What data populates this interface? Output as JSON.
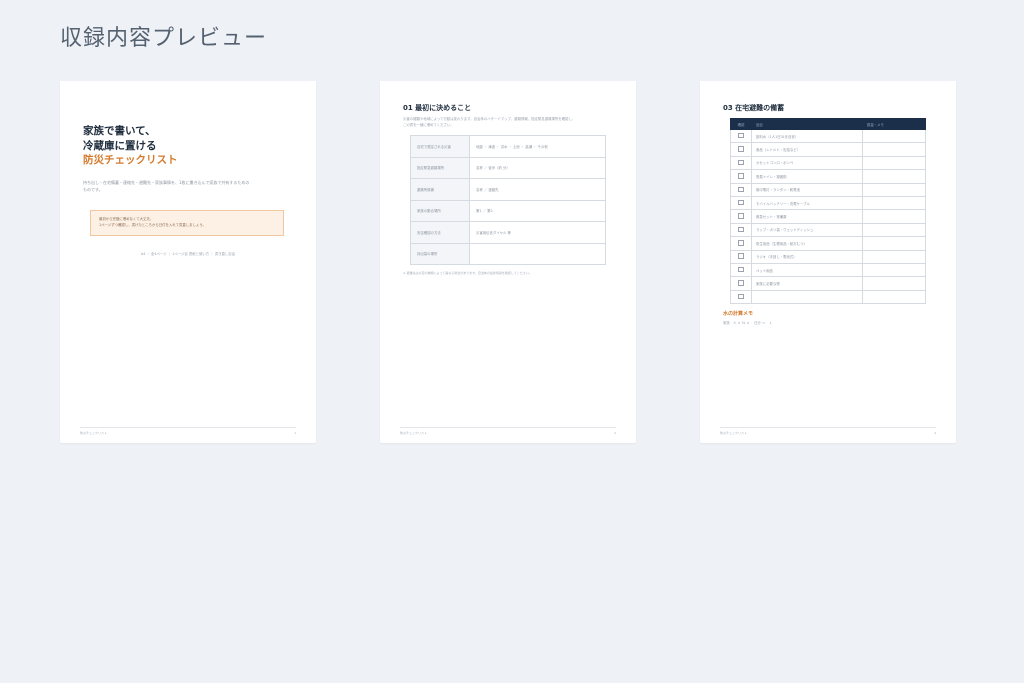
{
  "heading": "収録内容プレビュー",
  "page1": {
    "title_line1": "家族で書いて、",
    "title_line2": "冷蔵庫に置ける",
    "title_line3": "防災チェックリスト",
    "desc_line1": "持ち出し・在宅備蓄・連絡先・避難先・家族事情を、1枚に書き込んで家族で共有するための",
    "desc_line2": "ものです。",
    "notice_line1": "最初から完璧に埋めなくて大丈夫。",
    "notice_line2": "1ページずつ確認し、書けたところから日付を入れて見直しましょう。",
    "meta": "A4 ・ 全4ページ ｜ 1ページ目 表紙と使い方 ｜ 書き直し自由",
    "footer_left": "防災チェックリスト",
    "footer_right": "1"
  },
  "page2": {
    "title": "01 最初に決めること",
    "desc_line1": "災害の種類や地域によって行動は変わります。自治体のハザードマップ、避難情報、指定緊急避難場所を確認し、",
    "desc_line2": "この表を一緒に埋めてください。",
    "rows": [
      {
        "key": "自宅で想定される災害",
        "value": "地震 ・ 津波 ・ 洪水 ・ 土砂 ・ 高潮 ・ その他"
      },
      {
        "key": "指定緊急避難場所",
        "value": "名称 ／ 徒歩（約  分）"
      },
      {
        "key": "避難所候補",
        "value": "名称 ／ 連絡先"
      },
      {
        "key": "家族の集合場所",
        "value": "第1 ／ 第2"
      },
      {
        "key": "安否確認の方法",
        "value": "災害用伝言ダイヤル 等"
      },
      {
        "key": "持出袋の場所",
        "value": ""
      }
    ],
    "note": "※ 避難先は災害の種類によって異なる場合があります。自治体の最新情報を確認してください。",
    "footer_left": "防災チェックリスト",
    "footer_right": "2"
  },
  "page3": {
    "title": "03 在宅避難の備蓄",
    "header_col1": "確認",
    "header_col2": "品目",
    "header_col3": "数量・メモ",
    "items": [
      "飲料水（1人1日3Lを目安）",
      "食品（レトルト・缶詰など）",
      "カセットコンロ・ボンベ",
      "簡易トイレ・凝固剤",
      "懐中電灯・ランタン・乾電池",
      "モバイルバッテリー・充電ケーブル",
      "救急セット・常備薬",
      "ラップ・ポリ袋・ウェットティッシュ",
      "衛生用品（生理用品・紙おむつ）",
      "ラジオ（手回し・電池式）",
      "ペット用品",
      "家族に必要な物",
      ""
    ],
    "memo_title": "水の計算メモ",
    "memo_text": "家族　人 × 3L × 　日分 ＝ 　L",
    "footer_left": "防災チェックリスト",
    "footer_right": "4"
  },
  "colors": {
    "accent": "#d47a2c",
    "navy": "#1c2f4a",
    "background": "#eef2f6"
  }
}
